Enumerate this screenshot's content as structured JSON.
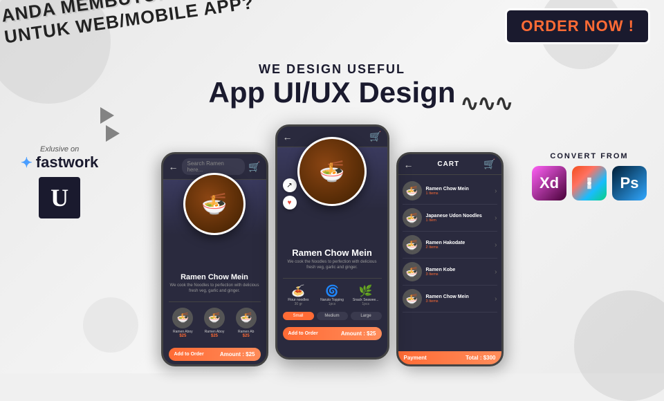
{
  "background": {
    "color": "#f0f0f0"
  },
  "banner": {
    "line1": "ANDA MEMBUTUHKAN DESAIN",
    "line2": "UNTUK WEB/MOBILE APP?"
  },
  "order_now": {
    "label": "ORDER NOW !"
  },
  "headline": {
    "sub": "WE DESIGN USEFUL",
    "main": "App UI/UX Design"
  },
  "fastwork": {
    "exclusive": "Exlusive on",
    "logo": "fastwork",
    "u_letter": "U"
  },
  "convert": {
    "label": "CONVERT FROM",
    "tools": [
      "Xd",
      "Fg",
      "Ps"
    ]
  },
  "phones": {
    "left": {
      "search_placeholder": "Search Ramen here...",
      "food_name": "Ramen Chow Mein",
      "food_desc": "We cook the Noodles to perfection with delicious fresh veg, garlic and ginger.",
      "thumbnails": [
        {
          "name": "Ramen Aboy",
          "price": "$25"
        },
        {
          "name": "Ramen Aboy",
          "price": "$25"
        },
        {
          "name": "Ramen Ab...",
          "price": "$25"
        }
      ],
      "add_btn": "Add to Order",
      "amount": "Amount : $25"
    },
    "center": {
      "food_name": "Ramen Chow Mein",
      "food_desc": "We cook the Noodles to perfection with delicious fresh veg, garlic and ginger.",
      "ingredients": [
        {
          "name": "Flour noodles",
          "amount": "30 gr"
        },
        {
          "name": "Naruto Topping",
          "amount": "1pcs"
        },
        {
          "name": "Snack Seawee...",
          "amount": "1pcs"
        }
      ],
      "sizes": [
        "Small",
        "Medium",
        "Large"
      ],
      "active_size": "Small",
      "add_btn": "Add to Order",
      "amount": "Amount : $25"
    },
    "right": {
      "title": "CART",
      "items": [
        {
          "name": "Ramen Chow Mein",
          "sub": "1 Items"
        },
        {
          "name": "Japanese Udon Noodles",
          "sub": "1 Item"
        },
        {
          "name": "Ramen Hakodate",
          "sub": "2 Items"
        },
        {
          "name": "Ramen Kobe",
          "sub": "3 Items"
        },
        {
          "name": "Ramen Chow Mein",
          "sub": "3 Items"
        }
      ],
      "pay_btn": "Payment",
      "total": "Total : $300"
    }
  },
  "decorations": {
    "wave": "∿∿∿",
    "food_emoji": "🍜"
  }
}
